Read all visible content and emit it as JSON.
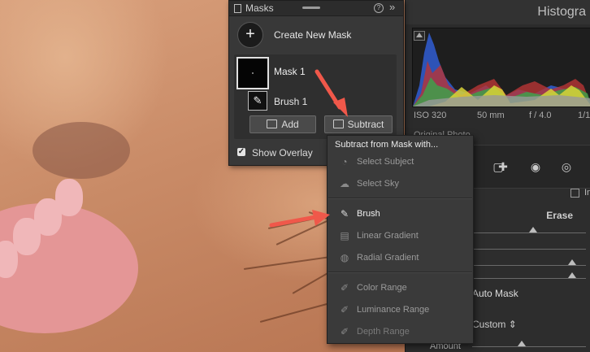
{
  "masks_panel": {
    "title": "Masks",
    "create_label": "Create New Mask",
    "mask_name": "Mask 1",
    "component_name": "Brush 1",
    "add_label": "Add",
    "subtract_label": "Subtract",
    "show_overlay_label": "Show Overlay",
    "show_overlay_checked": true
  },
  "subtract_menu": {
    "title": "Subtract from Mask with...",
    "items": [
      {
        "label": "Select Subject",
        "icon": "person-icon",
        "state": "dim"
      },
      {
        "label": "Select Sky",
        "icon": "sky-icon",
        "state": "dim"
      },
      {
        "label": "Brush",
        "icon": "brush-icon",
        "state": "bright"
      },
      {
        "label": "Linear Gradient",
        "icon": "linear-gradient-icon",
        "state": "dim"
      },
      {
        "label": "Radial Gradient",
        "icon": "radial-gradient-icon",
        "state": "dim"
      },
      {
        "label": "Color Range",
        "icon": "color-range-icon",
        "state": "dim"
      },
      {
        "label": "Luminance Range",
        "icon": "luminance-range-icon",
        "state": "dim"
      },
      {
        "label": "Depth Range",
        "icon": "depth-range-icon",
        "state": "dim"
      }
    ]
  },
  "histogram": {
    "title": "Histogra",
    "iso": "ISO 320",
    "focal": "50 mm",
    "aperture": "f / 4.0",
    "shutter": "1/1",
    "original_photo_label": "Original Photo"
  },
  "detail": {
    "erase_label": "Erase",
    "invert_label": "In",
    "auto_mask_label": "Auto Mask",
    "brush_preset_label": "Custom",
    "amount_label": "Amount"
  },
  "colors": {
    "panel_bg": "#383838",
    "menu_bg": "#3a3a3a",
    "arrow": "#f0584a",
    "skin": "#c98e6a"
  }
}
